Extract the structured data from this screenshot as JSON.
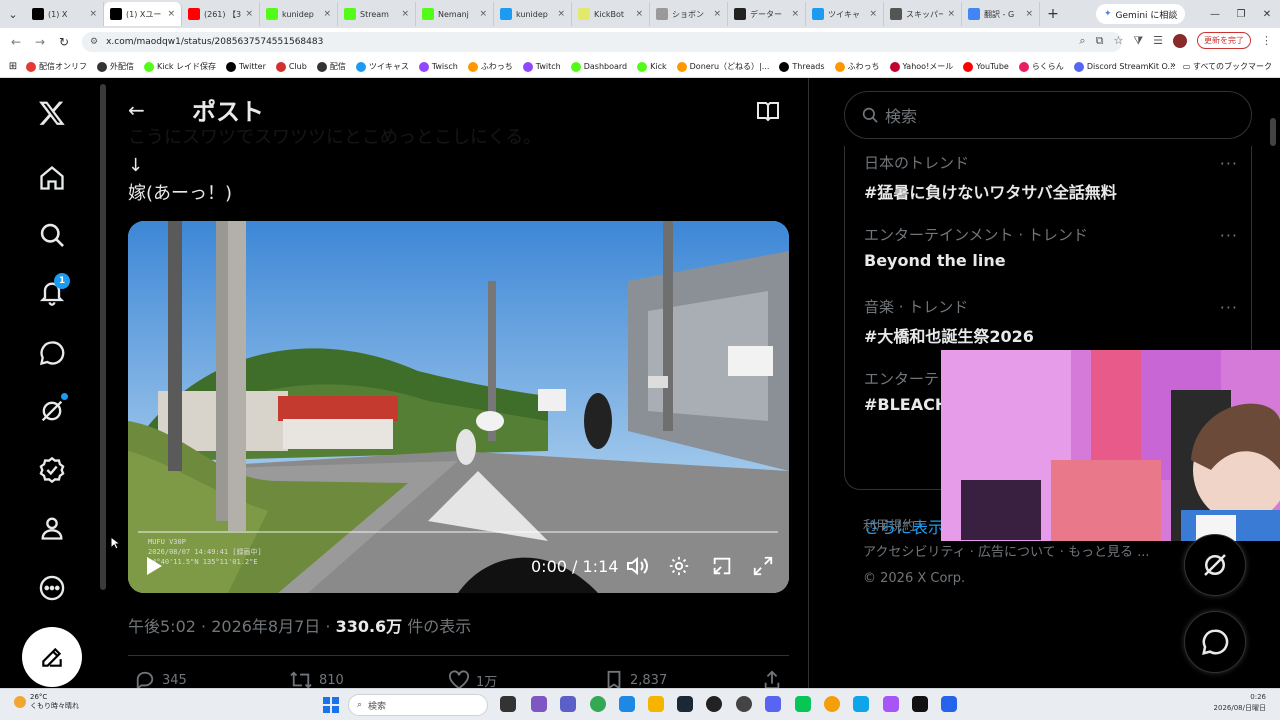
{
  "browser": {
    "tabs": [
      {
        "label": "(1) X",
        "color": "#000000"
      },
      {
        "label": "(1) Xユー",
        "color": "#000000",
        "active": true
      },
      {
        "label": "(261) 【3",
        "color": "#ff0000"
      },
      {
        "label": "kunidep",
        "color": "#53fc18"
      },
      {
        "label": "Stream",
        "color": "#53fc18"
      },
      {
        "label": "Nemanj",
        "color": "#53fc18"
      },
      {
        "label": "kunidep",
        "color": "#1d9bf0"
      },
      {
        "label": "KickBot",
        "color": "#e2e86b"
      },
      {
        "label": "ショボン",
        "color": "#999999"
      },
      {
        "label": "データー",
        "color": "#222222"
      },
      {
        "label": "ツイキャ",
        "color": "#1d9bf0"
      },
      {
        "label": "スキッパー",
        "color": "#555555"
      },
      {
        "label": "翻訳 - G",
        "color": "#4285f4"
      }
    ],
    "new_tab": "+",
    "gemini_label": "Gemini に相談",
    "url": "x.com/maodqw1/status/2085637574551568483",
    "update_label": "更新を完了",
    "bookmarks": [
      {
        "label": "配信オンリフ",
        "color": "#e53935"
      },
      {
        "label": "外配信",
        "color": "#333333"
      },
      {
        "label": "Kick レイド保存",
        "color": "#53fc18"
      },
      {
        "label": "Twitter",
        "color": "#000000"
      },
      {
        "label": "Club",
        "color": "#d32f2f"
      },
      {
        "label": "配信",
        "color": "#333333"
      },
      {
        "label": "ツイキャス",
        "color": "#1d9bf0"
      },
      {
        "label": "Twisch",
        "color": "#9146ff"
      },
      {
        "label": "ふわっち",
        "color": "#ff9800"
      },
      {
        "label": "Twitch",
        "color": "#9146ff"
      },
      {
        "label": "Dashboard",
        "color": "#53fc18"
      },
      {
        "label": "Kick",
        "color": "#53fc18"
      },
      {
        "label": "Doneru（どねる）|...",
        "color": "#ff9800"
      },
      {
        "label": "Threads",
        "color": "#000000"
      },
      {
        "label": "ふわっち",
        "color": "#ff9800"
      },
      {
        "label": "Yahoo!メール",
        "color": "#c3002f"
      },
      {
        "label": "YouTube",
        "color": "#ff0000"
      },
      {
        "label": "らくらん",
        "color": "#e91e63"
      },
      {
        "label": "Discord StreamKit O...",
        "color": "#5865f2"
      }
    ],
    "bookmarks_more": "»",
    "all_bookmarks": "すべてのブックマーク"
  },
  "nav": {
    "notifications_count": "1"
  },
  "header": {
    "title": "ポスト"
  },
  "tweet": {
    "line_cut": "こうにスワツでスワツツにとこめっとこしにくる。",
    "line_arrow": "↓",
    "line_last": "嫁(あーっ！)",
    "watermark_line1": "MUFU V30P",
    "watermark_line2": "2026/08/07  14:49:41  [録画中]",
    "watermark_line3": "34°40'11.5\"N 135°11'01.2\"E",
    "video_time": "0:00 / 1:14",
    "time": "午後5:02",
    "date": "2026年8月7日",
    "views_count": "330.6万",
    "views_suffix": " 件の表示",
    "separator": " · ",
    "replies": "345",
    "retweets": "810",
    "likes": "1万",
    "bookmarks": "2,837"
  },
  "sidebar": {
    "search_placeholder": "検索",
    "trends": [
      {
        "category": "日本のトレンド",
        "name": "#猛暑に負けないワタサバ全話無料"
      },
      {
        "category": "エンターテインメント · トレンド",
        "name": "Beyond the line"
      },
      {
        "category": "音楽 · トレンド",
        "name": "#大橋和也誕生祭2026"
      },
      {
        "category": "エンターテ",
        "name": "#BLEACH_"
      }
    ],
    "trend_more": "···",
    "show_more": "さらに表示",
    "footer_line1": "利用規約  ·",
    "footer_line2": "アクセシビリティ  ·  広告について  ·  もっと見る ...",
    "footer_line3": "© 2026 X Corp."
  },
  "taskbar": {
    "temp": "26°C",
    "weather": "くもり時々晴れ",
    "search_label": "検索",
    "time": "0:26",
    "date": "2026/08/日曜日"
  }
}
